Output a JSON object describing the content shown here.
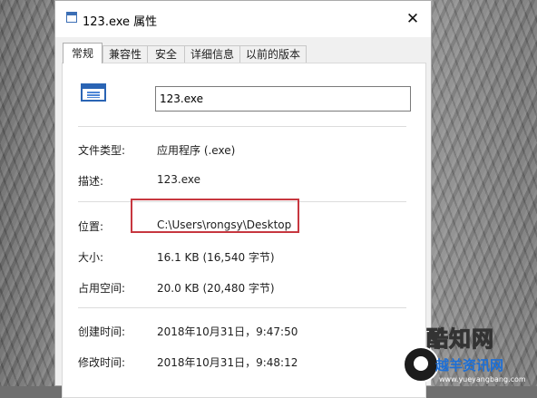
{
  "window": {
    "title": "123.exe 属性",
    "close_glyph": "✕"
  },
  "tabs": [
    "常规",
    "兼容性",
    "安全",
    "详细信息",
    "以前的版本"
  ],
  "general": {
    "file_name": "123.exe",
    "fields": {
      "type": {
        "label": "文件类型:",
        "value": "应用程序 (.exe)"
      },
      "description": {
        "label": "描述:",
        "value": "123.exe"
      },
      "location": {
        "label": "位置:",
        "value": "C:\\Users\\rongsy\\Desktop"
      },
      "size": {
        "label": "大小:",
        "value": "16.1 KB (16,540 字节)"
      },
      "size_on_disk": {
        "label": "占用空间:",
        "value": "20.0 KB (20,480 字节)"
      },
      "created": {
        "label": "创建时间:",
        "value": "2018年10月31日，9:47:50"
      },
      "modified": {
        "label": "修改时间:",
        "value": "2018年10月31日，9:48:12"
      }
    }
  },
  "watermark": {
    "brand": "酷知网",
    "name": "越羊资讯网",
    "url": "www.yueyangbang.com"
  },
  "colors": {
    "highlight_box": "#c7373f",
    "icon_blue": "#2a64b4"
  }
}
